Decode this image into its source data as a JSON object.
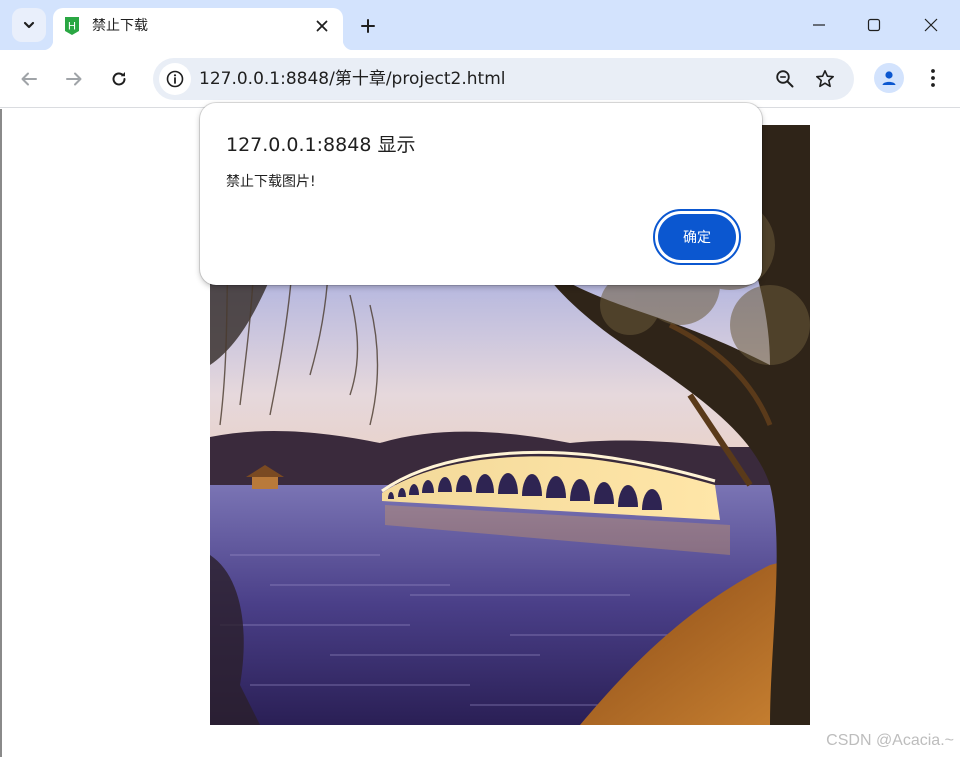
{
  "tab": {
    "title": "禁止下载",
    "favicon_icon": "hbuilder-favicon-icon",
    "favicon_letter": "H",
    "favicon_color": "#2aa743"
  },
  "toolbar": {
    "url": "127.0.0.1:8848/第十章/project2.html"
  },
  "dialog": {
    "title": "127.0.0.1:8848 显示",
    "message": "禁止下载图片!",
    "ok_label": "确定",
    "accent_color": "#0b57d0"
  },
  "page": {
    "image_description_icon": "summer-palace-seventeen-arch-bridge-photo"
  },
  "watermark": "CSDN @Acacia.~"
}
